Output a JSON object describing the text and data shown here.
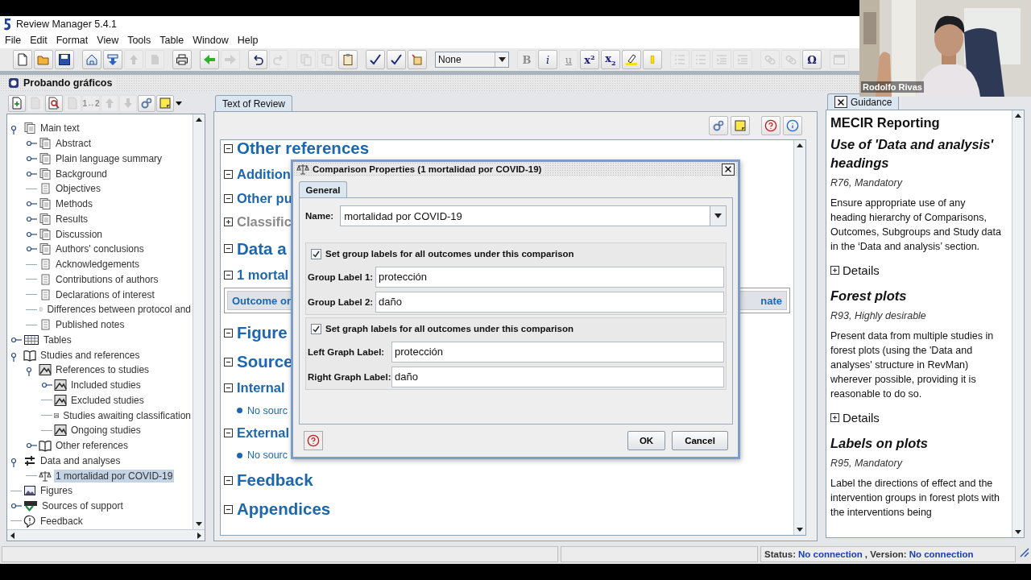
{
  "window": {
    "title": "Review Manager 5.4.1"
  },
  "menu": [
    "File",
    "Edit",
    "Format",
    "View",
    "Tools",
    "Table",
    "Window",
    "Help"
  ],
  "toolbar": {
    "groups": [
      {
        "buttons": [
          {
            "kind": "new",
            "disabled": false
          },
          {
            "kind": "open",
            "disabled": false
          },
          {
            "kind": "save",
            "disabled": false
          }
        ]
      },
      {
        "buttons": [
          {
            "kind": "home",
            "disabled": false
          },
          {
            "kind": "import",
            "disabled": false
          },
          {
            "kind": "up",
            "disabled": true
          },
          {
            "kind": "share",
            "disabled": true
          }
        ]
      },
      {
        "buttons": [
          {
            "kind": "print",
            "disabled": false
          }
        ]
      },
      {
        "buttons": [
          {
            "kind": "back",
            "disabled": false
          },
          {
            "kind": "forward",
            "disabled": true
          }
        ]
      },
      {
        "buttons": [
          {
            "kind": "undo",
            "disabled": false
          },
          {
            "kind": "redo",
            "disabled": true
          }
        ]
      },
      {
        "buttons": [
          {
            "kind": "cut",
            "disabled": true
          },
          {
            "kind": "copy",
            "disabled": true
          },
          {
            "kind": "paste",
            "disabled": false
          }
        ]
      },
      {
        "buttons": [
          {
            "kind": "check",
            "disabled": false
          },
          {
            "kind": "check",
            "disabled": false
          },
          {
            "kind": "wand",
            "disabled": false
          }
        ]
      },
      {
        "select": "None"
      },
      {
        "buttons": [
          {
            "kind": "bold",
            "label": "B",
            "disabled": true
          },
          {
            "kind": "italic",
            "label": "i",
            "disabled": false
          },
          {
            "kind": "underline",
            "label": "u",
            "disabled": true
          },
          {
            "kind": "sup",
            "label": "x$^{2}$",
            "disabled": false
          },
          {
            "kind": "sub",
            "label": "x$_{2}$",
            "disabled": false
          },
          {
            "kind": "highlight",
            "disabled": false
          },
          {
            "kind": "marker",
            "disabled": false
          }
        ]
      },
      {
        "buttons": [
          {
            "kind": "list",
            "disabled": true
          },
          {
            "kind": "list",
            "disabled": true
          },
          {
            "kind": "indent",
            "disabled": true
          },
          {
            "kind": "indent",
            "disabled": true
          }
        ]
      },
      {
        "buttons": [
          {
            "kind": "link",
            "disabled": true
          },
          {
            "kind": "link",
            "disabled": true
          },
          {
            "kind": "symbol",
            "label": "Ω",
            "disabled": false
          }
        ]
      },
      {
        "buttons": [
          {
            "kind": "window",
            "disabled": true
          }
        ]
      }
    ]
  },
  "review": {
    "title": "Probando gráficos"
  },
  "outline": {
    "tools": [
      {
        "kind": "add",
        "disabled": false
      },
      {
        "kind": "edit",
        "disabled": true
      },
      {
        "kind": "find",
        "disabled": false
      },
      {
        "kind": "edit",
        "disabled": true
      },
      {
        "kind": "text",
        "label": "1↔2",
        "disabled": true
      },
      {
        "kind": "up",
        "disabled": true
      },
      {
        "kind": "down",
        "disabled": true
      },
      {
        "kind": "gears",
        "disabled": false
      },
      {
        "kind": "note",
        "disabled": false
      }
    ],
    "items": [
      {
        "label": "Main text",
        "kind": "pages",
        "expanded": true,
        "selected": false,
        "children": [
          {
            "label": "Abstract",
            "kind": "pages",
            "expanded": false,
            "selected": false
          },
          {
            "label": "Plain language summary",
            "kind": "pages",
            "expanded": false,
            "selected": false
          },
          {
            "label": "Background",
            "kind": "pages",
            "expanded": false,
            "selected": false
          },
          {
            "label": "Objectives",
            "kind": "page",
            "selected": false
          },
          {
            "label": "Methods",
            "kind": "pages",
            "expanded": false,
            "selected": false
          },
          {
            "label": "Results",
            "kind": "pages",
            "expanded": false,
            "selected": false
          },
          {
            "label": "Discussion",
            "kind": "pages",
            "expanded": false,
            "selected": false
          },
          {
            "label": "Authors' conclusions",
            "kind": "pages",
            "expanded": false,
            "selected": false
          },
          {
            "label": "Acknowledgements",
            "kind": "page",
            "selected": false
          },
          {
            "label": "Contributions of authors",
            "kind": "page",
            "selected": false
          },
          {
            "label": "Declarations of interest",
            "kind": "page",
            "selected": false
          },
          {
            "label": "Differences between protocol and",
            "kind": "page",
            "selected": false
          },
          {
            "label": "Published notes",
            "kind": "page",
            "selected": false
          }
        ]
      },
      {
        "label": "Tables",
        "kind": "table",
        "expanded": false,
        "selected": false
      },
      {
        "label": "Studies and references",
        "kind": "book",
        "expanded": true,
        "selected": false,
        "children": [
          {
            "label": "References to studies",
            "kind": "studies",
            "expanded": true,
            "selected": false,
            "children": [
              {
                "label": "Included studies",
                "kind": "studies",
                "expanded": false,
                "selected": false
              },
              {
                "label": "Excluded studies",
                "kind": "studies",
                "selected": false
              },
              {
                "label": "Studies awaiting classification",
                "kind": "studies",
                "selected": false
              },
              {
                "label": "Ongoing studies",
                "kind": "studies",
                "selected": false
              }
            ]
          },
          {
            "label": "Other references",
            "kind": "book",
            "expanded": false,
            "selected": false
          }
        ]
      },
      {
        "label": "Data and analyses",
        "kind": "analyses",
        "expanded": true,
        "selected": false,
        "children": [
          {
            "label": "1 mortalidad por COVID-19",
            "kind": "scale",
            "selected": true
          }
        ]
      },
      {
        "label": "Figures",
        "kind": "figure",
        "selected": false
      },
      {
        "label": "Sources of support",
        "kind": "support",
        "expanded": false,
        "selected": false
      },
      {
        "label": "Feedback",
        "kind": "feedback",
        "selected": false
      }
    ]
  },
  "document": {
    "tab": {
      "label": "Text of Review",
      "selected": true
    },
    "blocks": [
      {
        "kind": "heading1",
        "text": "Other references",
        "expanded": true
      },
      {
        "kind": "heading2",
        "text": "Addition",
        "expanded": true
      },
      {
        "kind": "heading2",
        "text": "Other pu",
        "expanded": true
      },
      {
        "kind": "heading2",
        "text": "Classific",
        "expanded": false
      },
      {
        "kind": "heading1",
        "text": "Data a",
        "expanded": true
      },
      {
        "kind": "heading2",
        "text": "1 mortal",
        "expanded": true
      },
      {
        "kind": "table_row",
        "column_1": "Outcome or",
        "column_2": "nate"
      },
      {
        "kind": "heading1",
        "text": "Figure",
        "expanded": true
      },
      {
        "kind": "heading1",
        "text": "Source",
        "expanded": true
      },
      {
        "kind": "heading2",
        "text": "Internal",
        "expanded": true
      },
      {
        "kind": "bullet",
        "text": "No sourc"
      },
      {
        "kind": "heading2",
        "text": "External",
        "expanded": true
      },
      {
        "kind": "bullet",
        "text": "No sourc"
      },
      {
        "kind": "heading1",
        "text": "Feedback",
        "expanded": true
      },
      {
        "kind": "heading1",
        "text": "Appendices",
        "expanded": true
      }
    ]
  },
  "dialog": {
    "title": "Comparison Properties (1 mortalidad por COVID-19)",
    "tab": {
      "label": "General",
      "selected": true
    },
    "name": {
      "label": "Name:",
      "value": "mortalidad por COVID-19"
    },
    "group_labels": {
      "label": "Set group labels for all outcomes under this comparison",
      "checked": true,
      "fields": [
        {
          "label": "Group Label 1:",
          "value": "protección"
        },
        {
          "label": "Group Label 2:",
          "value": "daño"
        }
      ]
    },
    "graph_labels": {
      "label": "Set graph labels for all outcomes under this comparison",
      "checked": true,
      "fields": [
        {
          "label": "Left Graph Label:",
          "value": "protección"
        },
        {
          "label": "Right Graph Label:",
          "value": "daño"
        }
      ]
    },
    "buttons": [
      "OK",
      "Cancel"
    ]
  },
  "guidance": {
    "tab": "Guidance",
    "heading": "MECIR Reporting",
    "items": [
      {
        "title": "Use of 'Data and analysis' headings",
        "code": "R76, Mandatory",
        "text": "Ensure appropriate use of any heading hierarchy of Comparisons, Outcomes, Subgroups and Study data in the ‘Data and analysis’ section.",
        "details": "Details",
        "expanded": false
      },
      {
        "title": "Forest plots",
        "code": "R93, Highly desirable",
        "text": "Present data from multiple studies in forest plots (using the 'Data and analyses' structure in RevMan) wherever possible, providing it is reasonable to do so.",
        "details": "Details",
        "expanded": false
      },
      {
        "title": "Labels on plots",
        "code": "R95, Mandatory",
        "text": "Label the directions of effect and the intervention groups in forest plots with the interventions being"
      }
    ]
  },
  "status_bar": {
    "status_label": "Status:",
    "status": "No connection",
    "version_label": ", Version:",
    "version": "No connection"
  },
  "webcam": {
    "name": "Rodolfo Rivas"
  }
}
